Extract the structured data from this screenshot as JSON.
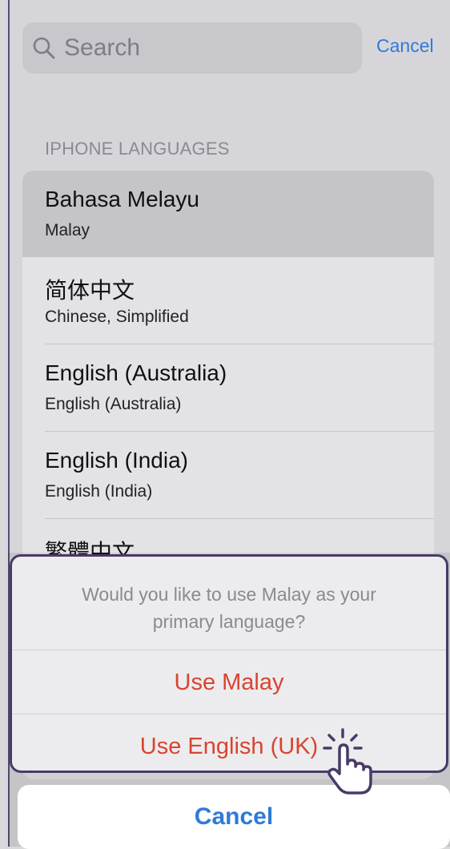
{
  "search": {
    "placeholder": "Search",
    "cancel_label": "Cancel"
  },
  "section_header": "IPHONE LANGUAGES",
  "languages": [
    {
      "name": "Bahasa Melayu",
      "subtitle": "Malay",
      "selected": true
    },
    {
      "name": "简体中文",
      "subtitle": "Chinese, Simplified",
      "selected": false
    },
    {
      "name": "English (Australia)",
      "subtitle": "English (Australia)",
      "selected": false
    },
    {
      "name": "English (India)",
      "subtitle": "English (India)",
      "selected": false
    },
    {
      "name": "繁體中文",
      "subtitle": "",
      "selected": false
    }
  ],
  "action_sheet": {
    "message_line1": "Would you like to use Malay as your",
    "message_line2": "primary language?",
    "primary_action": "Use Malay",
    "secondary_action": "Use English (UK)",
    "cancel_label": "Cancel"
  },
  "colors": {
    "accent_blue": "#2f7ad8",
    "destructive_red": "#d9442f",
    "highlight_border": "#4a3a68"
  },
  "icons": {
    "search": "search-icon",
    "cursor": "tap-hand-cursor-icon"
  }
}
